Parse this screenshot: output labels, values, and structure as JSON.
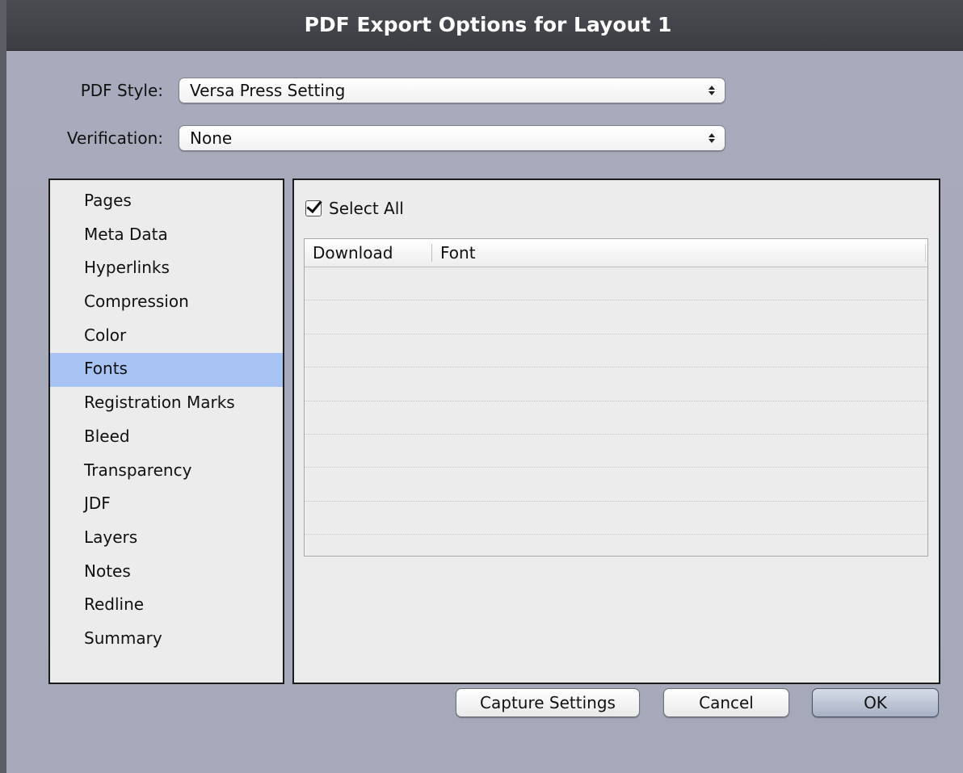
{
  "window": {
    "title": "PDF Export Options for Layout 1"
  },
  "pdf_style": {
    "label": "PDF Style:",
    "value": "Versa Press Setting"
  },
  "verification": {
    "label": "Verification:",
    "value": "None"
  },
  "sidebar": {
    "selected": "Fonts",
    "items": [
      {
        "label": "Pages"
      },
      {
        "label": "Meta Data"
      },
      {
        "label": "Hyperlinks"
      },
      {
        "label": "Compression"
      },
      {
        "label": "Color"
      },
      {
        "label": "Fonts"
      },
      {
        "label": "Registration Marks"
      },
      {
        "label": "Bleed"
      },
      {
        "label": "Transparency"
      },
      {
        "label": "JDF"
      },
      {
        "label": "Layers"
      },
      {
        "label": "Notes"
      },
      {
        "label": "Redline"
      },
      {
        "label": "Summary"
      }
    ]
  },
  "fonts_panel": {
    "select_all_label": "Select All",
    "select_all_checked": true,
    "table": {
      "columns": [
        "Download",
        "Font"
      ],
      "rows": []
    }
  },
  "buttons": {
    "capture": "Capture Settings",
    "cancel": "Cancel",
    "ok": "OK"
  },
  "colors": {
    "selection": "#a8c4f4",
    "titlebar": "#444650",
    "background": "#a8abbc"
  }
}
